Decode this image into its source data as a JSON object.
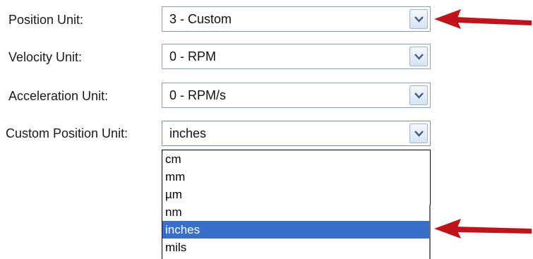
{
  "fields": [
    {
      "label": "Position Unit:",
      "value": "3 - Custom"
    },
    {
      "label": "Velocity Unit:",
      "value": "0 - RPM"
    },
    {
      "label": "Acceleration Unit:",
      "value": "0 - RPM/s"
    },
    {
      "label": "Custom Position Unit:",
      "value": "inches"
    }
  ],
  "dropdown": {
    "items": [
      "cm",
      "mm",
      "µm",
      "nm",
      "inches",
      "mils"
    ],
    "selected": "inches"
  },
  "icons": {
    "combo_button": "chevron-down-icon",
    "callout": "red-arrow-icon"
  },
  "colors": {
    "selection": "#3a6fc9",
    "arrow": "#c0141c",
    "border": "#8aa1bd"
  }
}
